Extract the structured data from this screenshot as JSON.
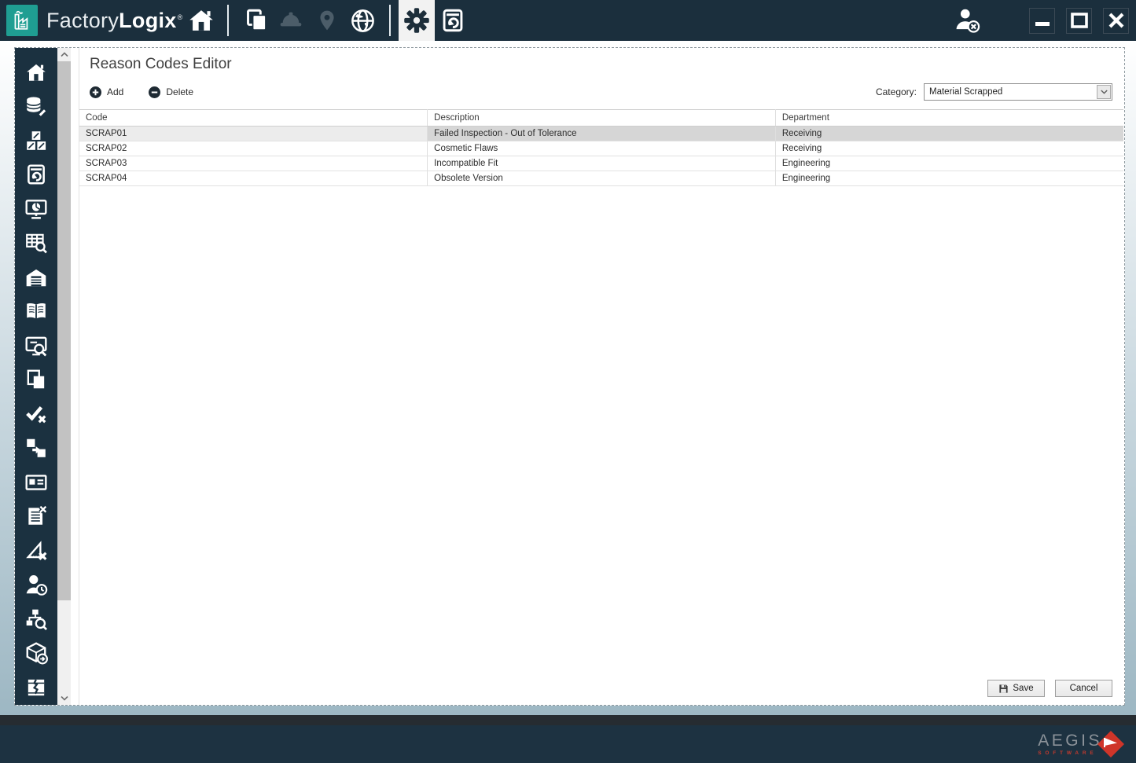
{
  "topbar": {
    "brand": {
      "light": "Factory",
      "bold": "Logix",
      "mark": "®"
    },
    "icons": [
      {
        "name": "home-icon",
        "state": "normal"
      },
      {
        "name": "layers-icon",
        "state": "normal"
      },
      {
        "name": "hardhat-icon",
        "state": "disabled"
      },
      {
        "name": "map-pin-icon",
        "state": "disabled"
      },
      {
        "name": "globe-icon",
        "state": "normal"
      },
      {
        "name": "settings-gear-icon",
        "state": "selected"
      },
      {
        "name": "document-history-icon",
        "state": "normal"
      }
    ],
    "window_controls": [
      "logout-user",
      "minimize",
      "maximize",
      "close"
    ]
  },
  "sidebar": {
    "items": [
      "home-icon",
      "database-edit-icon",
      "pallet-boxes-icon",
      "document-history-icon",
      "dashboard-monitor-icon",
      "table-search-icon",
      "warehouse-icon",
      "book-icon",
      "monitor-search-icon",
      "documents-icon",
      "check-x-icon",
      "transfer-icon",
      "id-card-icon",
      "list-delete-icon",
      "ruler-delete-icon",
      "user-clock-icon",
      "hierarchy-search-icon",
      "package-export-icon",
      "damaged-package-icon"
    ]
  },
  "editor": {
    "title": "Reason Codes Editor",
    "toolbar": {
      "add": "Add",
      "delete": "Delete"
    },
    "category": {
      "label": "Category:",
      "value": "Material Scrapped"
    },
    "table": {
      "columns": [
        "Code",
        "Description",
        "Department"
      ],
      "rows": [
        {
          "code": "SCRAP01",
          "description": "Failed Inspection - Out of Tolerance",
          "department": "Receiving",
          "selected": true
        },
        {
          "code": "SCRAP02",
          "description": "Cosmetic Flaws",
          "department": "Receiving",
          "selected": false
        },
        {
          "code": "SCRAP03",
          "description": "Incompatible Fit",
          "department": "Engineering",
          "selected": false
        },
        {
          "code": "SCRAP04",
          "description": "Obsolete Version",
          "department": "Engineering",
          "selected": false
        }
      ]
    },
    "actions": {
      "save": "Save",
      "cancel": "Cancel"
    }
  },
  "footer": {
    "brand": "AEGIS",
    "brand_sub": "SOFTWARE"
  },
  "colors": {
    "topbar": "#1b2f3d",
    "sidebar": "#1b3140",
    "accent_teal": "#1f9e92",
    "brand_red": "#c23a2e",
    "selected_row": "#d6d6d6",
    "current_cell": "#ececec"
  }
}
